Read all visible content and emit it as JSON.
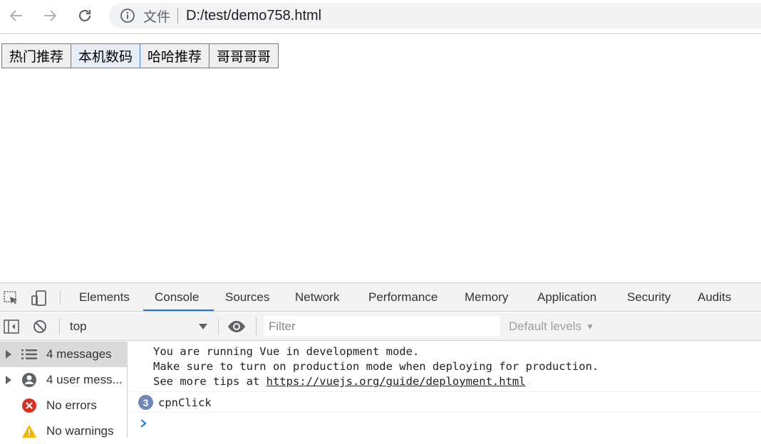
{
  "browser": {
    "file_label": "文件",
    "url": "D:/test/demo758.html"
  },
  "page": {
    "buttons": [
      {
        "label": "热门推荐"
      },
      {
        "label": "本机数码"
      },
      {
        "label": "哈哈推荐"
      },
      {
        "label": "哥哥哥哥"
      }
    ]
  },
  "devtools": {
    "tabs": [
      {
        "label": "Elements"
      },
      {
        "label": "Console"
      },
      {
        "label": "Sources"
      },
      {
        "label": "Network"
      },
      {
        "label": "Performance"
      },
      {
        "label": "Memory"
      },
      {
        "label": "Application"
      },
      {
        "label": "Security"
      },
      {
        "label": "Audits"
      }
    ],
    "active_tab": "Console",
    "toolbar": {
      "context": "top",
      "filter_placeholder": "Filter",
      "levels": "Default levels"
    },
    "sidebar": [
      {
        "label": "4 messages",
        "icon": "list-icon",
        "expandable": true,
        "selected": true
      },
      {
        "label": "4 user mess...",
        "icon": "user-icon",
        "expandable": true,
        "selected": false
      },
      {
        "label": "No errors",
        "icon": "error-icon",
        "expandable": false,
        "selected": false
      },
      {
        "label": "No warnings",
        "icon": "warning-icon",
        "expandable": false,
        "selected": false
      }
    ],
    "console": {
      "vue_line1": "You are running Vue in development mode.",
      "vue_line2": "Make sure to turn on production mode when deploying for production.",
      "vue_line3_prefix": "See more tips at ",
      "vue_link": "https://vuejs.org/guide/deployment.html",
      "repeat_count": "3",
      "log_message": "cpnClick"
    },
    "colors": {
      "accent": "#1a73e8",
      "badge": "#6f87b8",
      "error": "#d93025",
      "warning": "#f4b400"
    }
  }
}
